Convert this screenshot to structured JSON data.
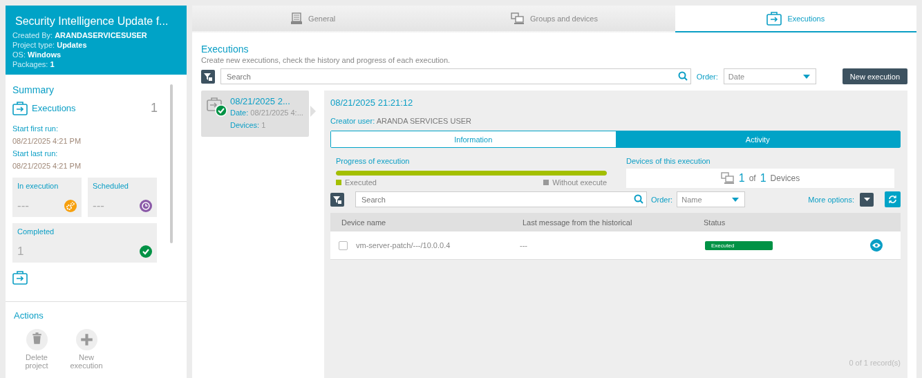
{
  "project": {
    "title": "Security Intelligence Update f...",
    "meta": [
      {
        "label": "Created By:",
        "value": "ARANDASERVICESUSER"
      },
      {
        "label": "Project type:",
        "value": "Updates"
      },
      {
        "label": "OS:",
        "value": "Windows"
      },
      {
        "label": "Packages:",
        "value": "1"
      }
    ]
  },
  "summary": {
    "title": "Summary",
    "executions_label": "Executions",
    "executions_count": "1",
    "first_run_label": "Start first run:",
    "first_run": "08/21/2025 4:21 PM",
    "last_run_label": "Start last run:",
    "last_run": "08/21/2025 4:21 PM",
    "cards": [
      {
        "kind": "in_execution",
        "label": "In execution",
        "value": "---"
      },
      {
        "kind": "scheduled",
        "label": "Scheduled",
        "value": "---"
      },
      {
        "kind": "completed",
        "label": "Completed",
        "value": "1"
      }
    ]
  },
  "actions": {
    "title": "Actions",
    "items": [
      {
        "kind": "delete",
        "label": "Delete project"
      },
      {
        "kind": "add",
        "label": "New execution"
      }
    ]
  },
  "tabs": [
    {
      "kind": "general",
      "label": "General",
      "selected": false
    },
    {
      "kind": "devices",
      "label": "Groups and devices",
      "selected": false
    },
    {
      "kind": "executions",
      "label": "Executions",
      "selected": true
    }
  ],
  "executions": {
    "title": "Executions",
    "description": "Create new executions, check the history and progress of each execution.",
    "search_placeholder": "Search",
    "order_label": "Order:",
    "order_value": "Date",
    "new_button": "New execution"
  },
  "execution_list": [
    {
      "title": "08/21/2025 2...",
      "date_label": "Date:",
      "date": "08/21/2025 4:...",
      "devices_label": "Devices:",
      "devices": "1",
      "selected": true
    }
  ],
  "detail": {
    "title": "08/21/2025 21:21:12",
    "creator_label": "Creator user:",
    "creator": "ARANDA SERVICES USER",
    "views": [
      {
        "label": "Information",
        "selected": false
      },
      {
        "label": "Activity",
        "selected": true
      }
    ],
    "progress": {
      "title": "Progress of execution",
      "level": 1,
      "legend": [
        "Executed",
        "Without execute"
      ]
    },
    "devices_box": {
      "title": "Devices of this execution",
      "count": "1",
      "of": "of",
      "total": "1",
      "unit": "Devices"
    },
    "search_placeholder": "Search",
    "order_label": "Order:",
    "order_value": "Name",
    "more_options": "More options:",
    "table": {
      "columns": [
        "Device name",
        "Last message from the historical",
        "Status"
      ],
      "rows": [
        {
          "device": "vm-server-patch/---/10.0.0.4",
          "message": "---",
          "status": "Executed",
          "checked": false
        }
      ]
    },
    "footer": "0 of 1 record(s)"
  }
}
